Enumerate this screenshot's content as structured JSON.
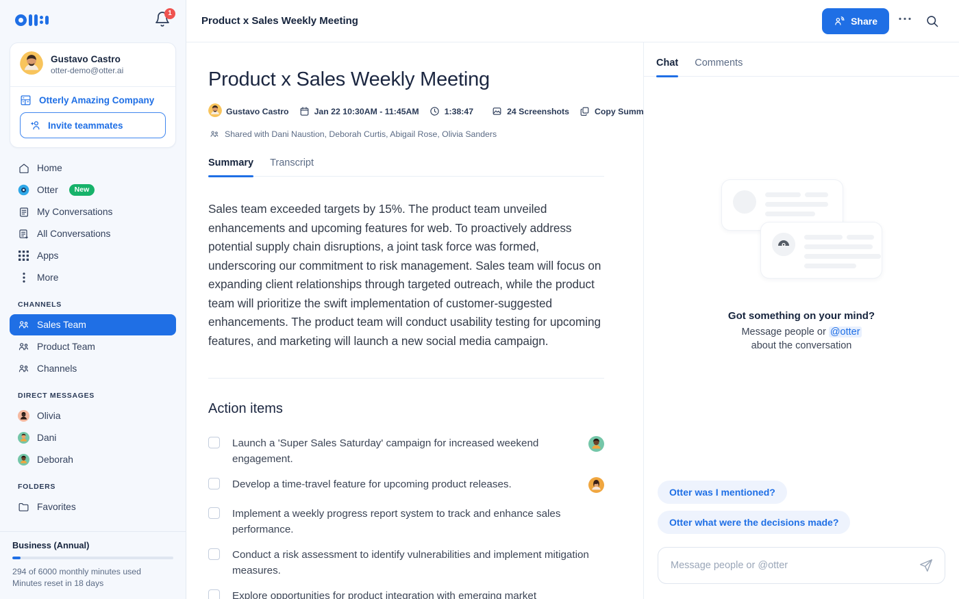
{
  "brand": {
    "logo_name": "otter-logo",
    "accent": "#1f6fe5",
    "badge_green": "#17b26a",
    "badge_red": "#ef5350"
  },
  "sidebar": {
    "notification_count": "1",
    "profile": {
      "name": "Gustavo Castro",
      "email": "otter-demo@otter.ai",
      "org": "Otterly Amazing Company",
      "invite_label": "Invite teammates"
    },
    "nav": [
      {
        "label": "Home",
        "icon": "home-icon"
      },
      {
        "label": "Otter",
        "icon": "otter-icon",
        "badge": "New"
      },
      {
        "label": "My Conversations",
        "icon": "document-icon"
      },
      {
        "label": "All Conversations",
        "icon": "documents-icon"
      },
      {
        "label": "Apps",
        "icon": "grid-icon"
      },
      {
        "label": "More",
        "icon": "kebab-icon"
      }
    ],
    "channels_title": "CHANNELS",
    "channels": [
      {
        "label": "Sales Team",
        "active": true
      },
      {
        "label": "Product Team",
        "active": false
      },
      {
        "label": "Channels",
        "active": false
      }
    ],
    "dm_title": "DIRECT MESSAGES",
    "dms": [
      {
        "label": "Olivia",
        "skin": "#3a2a24",
        "bg": "#f5b9a0",
        "hair": "#2b1c16"
      },
      {
        "label": "Dani",
        "skin": "#e9a36b",
        "bg": "#74c6a8",
        "hair": "#2e2119"
      },
      {
        "label": "Deborah",
        "skin": "#6b4229",
        "bg": "#74c6a8",
        "hair": "#231510"
      }
    ],
    "folders_title": "FOLDERS",
    "folders": [
      {
        "label": "Favorites",
        "icon": "folder-icon"
      }
    ],
    "plan": {
      "name": "Business (Annual)",
      "progress_percent": 5,
      "usage": "294 of 6000 monthly minutes used",
      "reset": "Minutes reset in 18 days"
    }
  },
  "topbar": {
    "title": "Product x Sales Weekly Meeting",
    "share_label": "Share",
    "more_icon": "ellipsis-icon",
    "search_icon": "search-icon"
  },
  "doc": {
    "title": "Product x Sales Weekly Meeting",
    "meta": {
      "owner": "Gustavo Castro",
      "date": "Jan 22 10:30AM - 11:45AM",
      "duration": "1:38:47",
      "screenshots": "24 Screenshots",
      "copy_summary": "Copy Summary"
    },
    "shared_with": "Shared with Dani Naustion, Deborah Curtis, Abigail Rose, Olivia Sanders",
    "tabs": [
      {
        "label": "Summary",
        "active": true
      },
      {
        "label": "Transcript",
        "active": false
      }
    ],
    "summary": "Sales team exceeded targets by 15%. The product team unveiled enhancements and upcoming features for web. To proactively address potential supply chain disruptions, a joint task force was formed, underscoring our commitment to risk management. Sales team will focus on expanding client relationships through targeted outreach, while the product team will prioritize the swift implementation of customer-suggested enhancements. The product team will conduct usability testing for upcoming features, and marketing will launch a new social media campaign.",
    "action_items_title": "Action items",
    "action_items": [
      {
        "text": "Launch a 'Super Sales Saturday' campaign for increased weekend engagement.",
        "avatar": {
          "bg": "#74c6a8",
          "skin": "#6b4229",
          "hair": "#231510",
          "shirt": "#f0a63f"
        }
      },
      {
        "text": "Develop a time-travel feature for upcoming product releases.",
        "avatar": {
          "bg": "#f0a63f",
          "skin": "#e3a57a",
          "hair": "#3a2018",
          "shirt": "#f7e6dd"
        }
      },
      {
        "text": "Implement a weekly progress report system to track and enhance sales performance.",
        "avatar": null
      },
      {
        "text": "Conduct a risk assessment to identify vulnerabilities and implement mitigation measures.",
        "avatar": null
      },
      {
        "text": "Explore opportunities for product integration with emerging market",
        "avatar": null
      }
    ]
  },
  "chat": {
    "tabs": [
      {
        "label": "Chat",
        "active": true
      },
      {
        "label": "Comments",
        "active": false
      }
    ],
    "empty_heading": "Got something on your mind?",
    "empty_line1_pre": "Message people or ",
    "empty_mention": "@otter",
    "empty_line2": "about the conversation",
    "suggestions": [
      "Otter was I mentioned?",
      "Otter what were the decisions made?"
    ],
    "composer_placeholder": "Message people or @otter",
    "send_icon": "send-icon"
  }
}
